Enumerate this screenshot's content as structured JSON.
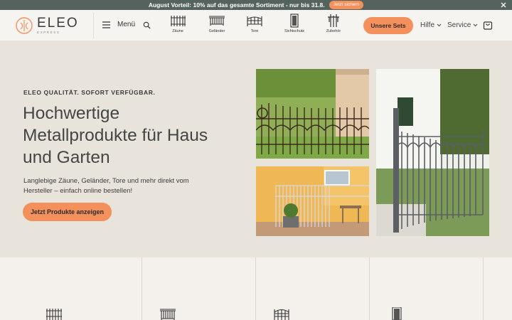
{
  "promo": {
    "text": "August Vorteil: 10% auf das gesamte Sortiment - nur bis 31.8.",
    "button": "Jetzt sichern",
    "close_icon": "close-icon"
  },
  "header": {
    "logo_name": "ELEO",
    "logo_sub": "EXPRESS",
    "menu_label": "Menü",
    "categories": [
      {
        "label": "Zäune",
        "icon": "fence-icon"
      },
      {
        "label": "Geländer",
        "icon": "railing-icon"
      },
      {
        "label": "Tore",
        "icon": "gate-icon"
      },
      {
        "label": "Sichtschutz",
        "icon": "privacy-screen-icon"
      },
      {
        "label": "Zubehör",
        "icon": "post-accessory-icon"
      }
    ],
    "sets_button": "Unsere Sets",
    "help": "Hilfe",
    "service": "Service"
  },
  "hero": {
    "eyebrow": "ELEO QUALITÄT. SOFORT VERFÜGBAR.",
    "headline": "Hochwertige Metallprodukte für Haus und Garten",
    "description": "Langlebige Zäune, Geländer, Tore und mehr direkt vom Hersteller – einfach online bestellen!",
    "cta": "Jetzt Produkte anzeigen"
  },
  "colors": {
    "accent": "#f3905c",
    "promo_bg": "#55635e",
    "hero_bg": "#e9e4db",
    "page_bg": "#f4f1ec"
  }
}
